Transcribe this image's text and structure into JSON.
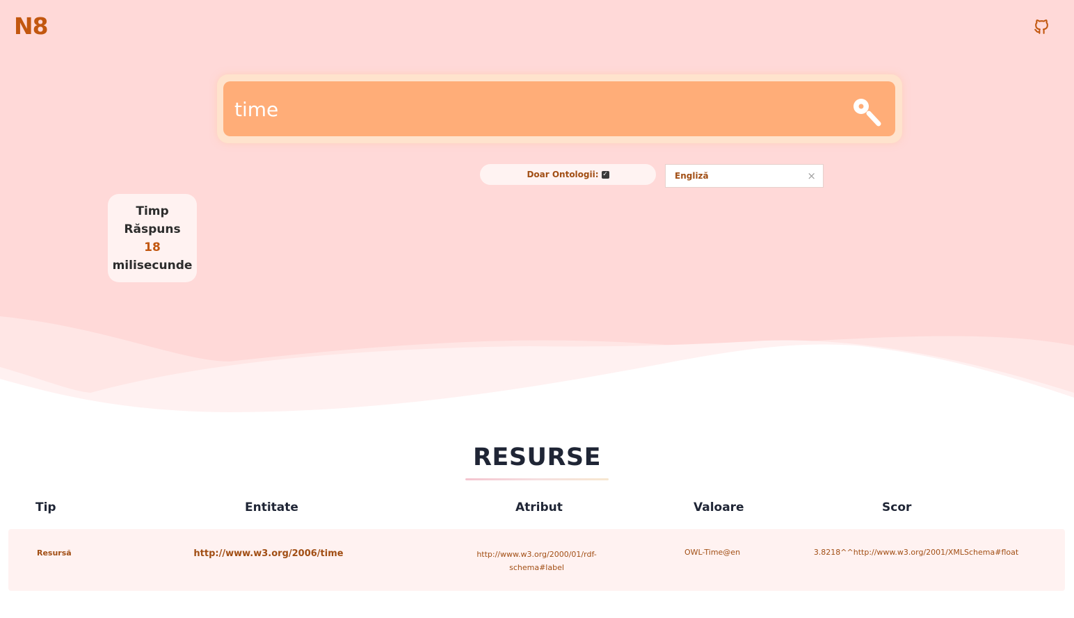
{
  "app": {
    "logo": "N8"
  },
  "search": {
    "value": "time"
  },
  "filters": {
    "ontology_label": "Doar Ontologii:",
    "ontology_checked": true,
    "language_value": "Engliză",
    "clear_symbol": "×"
  },
  "response_time": {
    "line1": "Timp",
    "line2": "Răspuns",
    "value": "18",
    "unit": "milisecunde"
  },
  "results": {
    "title": "RESURSE",
    "columns": [
      "Tip",
      "Entitate",
      "Atribut",
      "Valoare",
      "Scor"
    ],
    "rows": [
      {
        "tip": "Resursă",
        "entitate": "http://www.w3.org/2006/time",
        "atribut_line1": "http://www.w3.org/2000/01/rdf-",
        "atribut_line2": "schema#label",
        "valoare": "OWL-Time@en",
        "scor": "3.8218^^http://www.w3.org/2001/XMLSchema#float"
      }
    ]
  },
  "colors": {
    "accent": "#c2570f",
    "hero_bg": "#ffd9d8",
    "search_bg": "#ffad78",
    "text_dark": "#1f2535"
  }
}
